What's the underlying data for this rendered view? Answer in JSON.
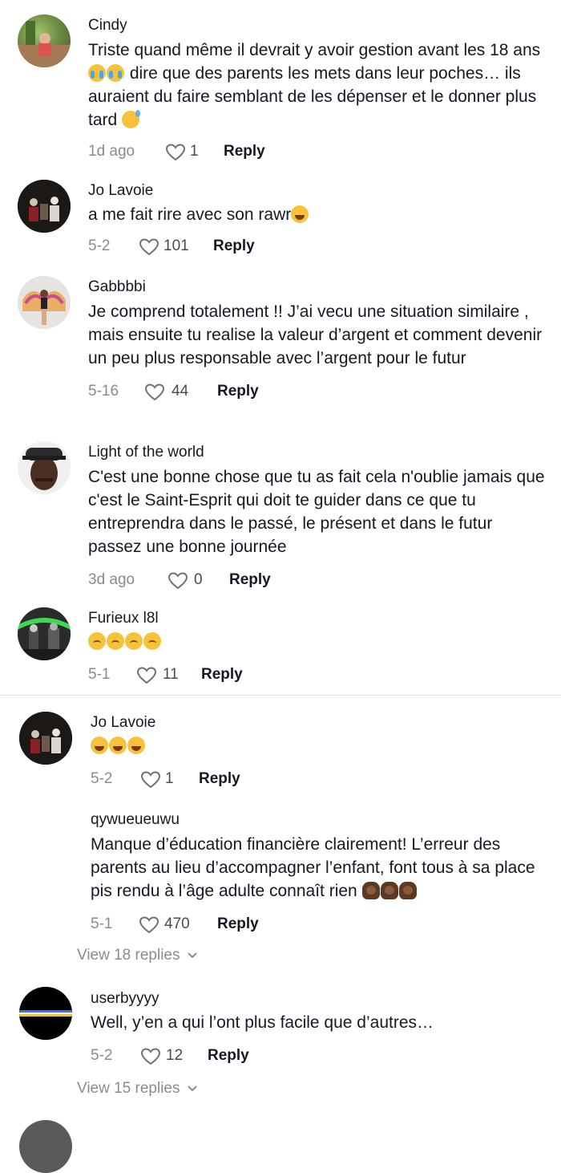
{
  "comments": [
    {
      "username": "Cindy",
      "text": "Triste quand même il devrait y avoir gestion avant les 18 ans",
      "text2": " dire que des parents les mets dans leur poches… ils auraient du faire semblant de les dépenser et le donner plus tard ",
      "date": "1d ago",
      "likes": "1",
      "reply": "Reply"
    },
    {
      "username": "Jo Lavoie",
      "text": "a me fait rire avec son rawr",
      "date": "5-2",
      "likes": "101",
      "reply": "Reply"
    },
    {
      "username": "Gabbbbi",
      "text": "Je comprend totalement !! J’ai vecu une situation similaire , mais ensuite tu realise la valeur d’argent et comment devenir un peu plus responsable avec l’argent pour le futur",
      "date": "5-16",
      "likes": "44",
      "reply": "Reply"
    },
    {
      "username": "Light of the world",
      "text": "C'est une bonne chose que tu as fait cela n'oublie jamais que c'est le Saint-Esprit qui doit te guider dans ce que tu entreprendra dans le passé, le présent et dans le futur passez une bonne journée",
      "date": "3d ago",
      "likes": "0",
      "reply": "Reply"
    },
    {
      "username": "Furieux l8l",
      "text": "",
      "date": "5-1",
      "likes": "11",
      "reply": "Reply"
    },
    {
      "username": "Jo Lavoie",
      "text": "",
      "date": "5-2",
      "likes": "1",
      "reply": "Reply"
    },
    {
      "username": "qywueueuwu",
      "text": "Manque d’éducation financière clairement! L’erreur des parents au lieu d’accompagner l’enfant, font tous à sa place pis rendu à l’âge adulte connaît rien ",
      "date": "5-1",
      "likes": "470",
      "reply": "Reply"
    },
    {
      "username": "userbyyyy",
      "text": "Well, y’en a qui l’ont plus facile que d’autres…",
      "date": "5-2",
      "likes": "12",
      "reply": "Reply"
    }
  ],
  "view_replies": [
    "View 18 replies",
    "View 15 replies"
  ],
  "colors": {
    "text": "#161823",
    "meta": "#8a8b91",
    "divider": "#e3e3e5"
  }
}
